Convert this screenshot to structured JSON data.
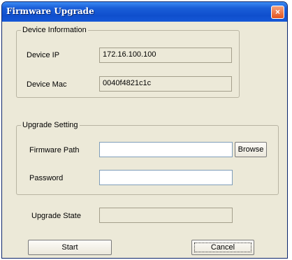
{
  "window": {
    "title": "Firmware Upgrade",
    "close_glyph": "×"
  },
  "device_info": {
    "legend": "Device Information",
    "ip_label": "Device IP",
    "ip_value": "172.16.100.100",
    "mac_label": "Device Mac",
    "mac_value": "0040f4821c1c"
  },
  "upgrade_setting": {
    "legend": "Upgrade Setting",
    "path_label": "Firmware Path",
    "path_value": "",
    "browse_label": "Browse",
    "password_label": "Password",
    "password_value": ""
  },
  "upgrade_state": {
    "label": "Upgrade State",
    "value": ""
  },
  "buttons": {
    "start_label": "Start",
    "cancel_label": "Cancel"
  }
}
